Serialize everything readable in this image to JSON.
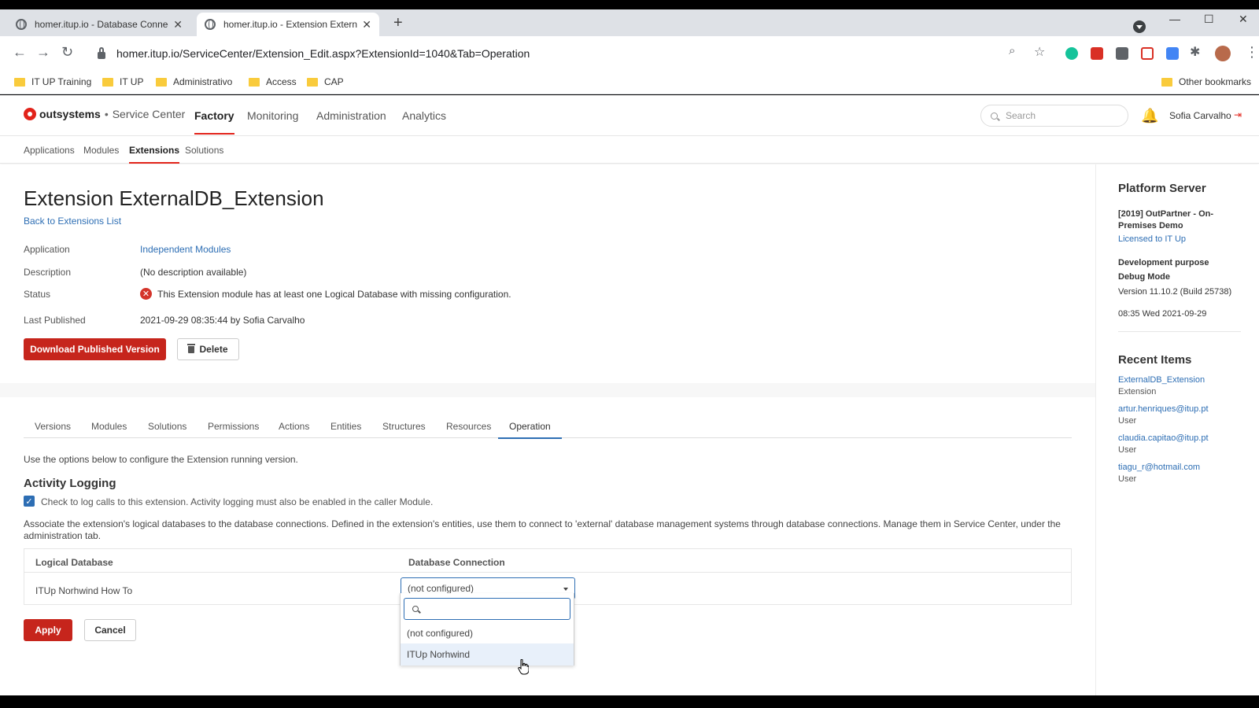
{
  "browser": {
    "tabs": [
      {
        "title": "homer.itup.io - Database Connec"
      },
      {
        "title": "homer.itup.io - Extension Extern"
      }
    ],
    "url": "homer.itup.io/ServiceCenter/Extension_Edit.aspx?ExtensionId=1040&Tab=Operation",
    "bookmarks": [
      "IT UP Training",
      "IT UP",
      "Administrativo",
      "Access",
      "CAP"
    ],
    "other_bookmarks": "Other bookmarks"
  },
  "header": {
    "brand": "outsystems",
    "separator": "•",
    "product": "Service Center",
    "nav": [
      "Factory",
      "Monitoring",
      "Administration",
      "Analytics"
    ],
    "search_placeholder": "Search",
    "user": "Sofia Carvalho"
  },
  "subnav": [
    "Applications",
    "Modules",
    "Extensions",
    "Solutions"
  ],
  "page": {
    "title": "Extension ExternalDB_Extension",
    "back_link": "Back to Extensions List",
    "properties": [
      {
        "label": "Application",
        "value": "Independent Modules"
      },
      {
        "label": "Description",
        "value": "(No description available)"
      },
      {
        "label": "Status",
        "value": "This Extension module has at least one Logical Database with missing configuration."
      },
      {
        "label": "Last Published",
        "value": "2021-09-29 08:35:44 by Sofia Carvalho"
      }
    ],
    "download_label": "Download Published Version",
    "delete_label": "Delete",
    "tabs": [
      "Versions",
      "Modules",
      "Solutions",
      "Permissions",
      "Actions",
      "Entities",
      "Structures",
      "Resources",
      "Operation"
    ],
    "intro": "Use the options below to configure the Extension running version.",
    "activity_title": "Activity Logging",
    "activity_check": "Check to log calls to this extension. Activity logging must also be enabled in the caller Module.",
    "assoc_text": "Associate the extension's logical databases to the database connections. Defined in the extension's entities, use them to connect to 'external' database management systems through database connections. Manage them in Service Center, under the administration tab.",
    "table": {
      "col1": "Logical Database",
      "col2": "Database Connection",
      "row_db": "ITUp Norhwind How To",
      "selected": "(not configured)"
    },
    "dropdown_options": [
      "(not configured)",
      "ITUp Norhwind"
    ],
    "apply_label": "Apply",
    "cancel_label": "Cancel"
  },
  "sidebar": {
    "platform_title": "Platform Server",
    "license_name": "[2019] OutPartner - On-Premises Demo",
    "license_link": "Licensed to IT Up",
    "purpose": "Development purpose",
    "debug": "Debug Mode",
    "version": "Version 11.10.2 (Build 25738)",
    "datetime": "08:35 Wed 2021-09-29",
    "recent_title": "Recent Items",
    "recent": [
      {
        "name": "ExternalDB_Extension",
        "type": "Extension"
      },
      {
        "name": "artur.henriques@itup.pt",
        "type": "User"
      },
      {
        "name": "claudia.capitao@itup.pt",
        "type": "User"
      },
      {
        "name": "tiagu_r@hotmail.com",
        "type": "User"
      }
    ]
  },
  "colors": {
    "accent_red": "#c6251c",
    "link_blue": "#2d6eb4"
  }
}
